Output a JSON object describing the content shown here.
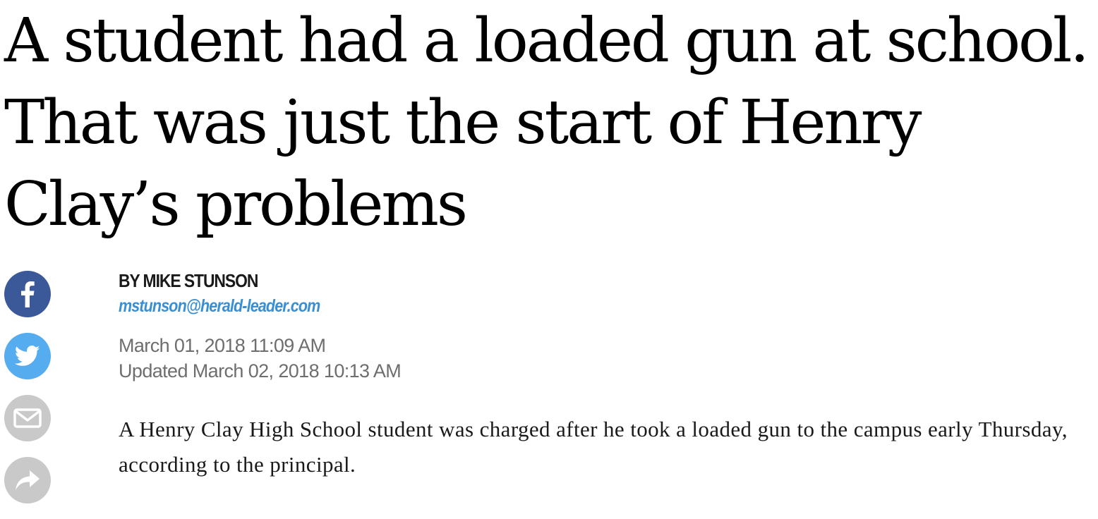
{
  "article": {
    "headline": "A student had a loaded gun at school. That was just the start of Henry Clay’s problems",
    "byline": "BY MIKE STUNSON",
    "author_email": "mstunson@herald-leader.com",
    "published": "March 01, 2018 11:09 AM",
    "updated": "Updated March 02, 2018 10:13 AM",
    "lede": "A Henry Clay High School student was charged after he took a loaded gun to the campus early Thursday, according to the principal."
  },
  "share": {
    "buttons": [
      {
        "icon": "facebook-icon",
        "color": "#3b5998"
      },
      {
        "icon": "twitter-icon",
        "color": "#55acee"
      },
      {
        "icon": "email-icon",
        "color": "#c9c9c9"
      },
      {
        "icon": "share-arrow-icon",
        "color": "#c9c9c9"
      }
    ]
  }
}
